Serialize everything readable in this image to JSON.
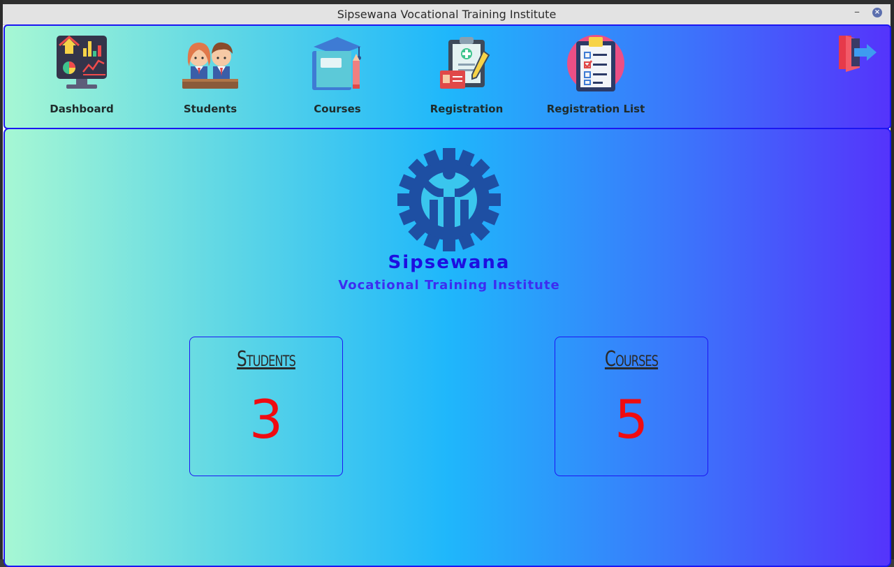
{
  "window": {
    "title": "Sipsewana Vocational Training Institute",
    "min_glyph": "–",
    "close_glyph": "×"
  },
  "nav": {
    "items": [
      {
        "label": "Dashboard",
        "icon": "dashboard-monitor-icon"
      },
      {
        "label": "Students",
        "icon": "students-icon"
      },
      {
        "label": "Courses",
        "icon": "courses-book-icon"
      },
      {
        "label": "Registration",
        "icon": "registration-clipboard-icon"
      },
      {
        "label": "Registration List",
        "icon": "registration-list-icon"
      }
    ],
    "logout_icon": "logout-door-icon"
  },
  "brand": {
    "name": "Sipsewana",
    "subtitle": "Vocational Training Institute",
    "logo_icon": "gear-person-logo-icon"
  },
  "stats": {
    "students": {
      "title": "Students",
      "value": "3"
    },
    "courses": {
      "title": "Courses",
      "value": "5"
    }
  },
  "colors": {
    "border": "#1c16f2",
    "value": "#f00b10",
    "brand": "#1d0fe0",
    "logo": "#1e4fa3"
  }
}
